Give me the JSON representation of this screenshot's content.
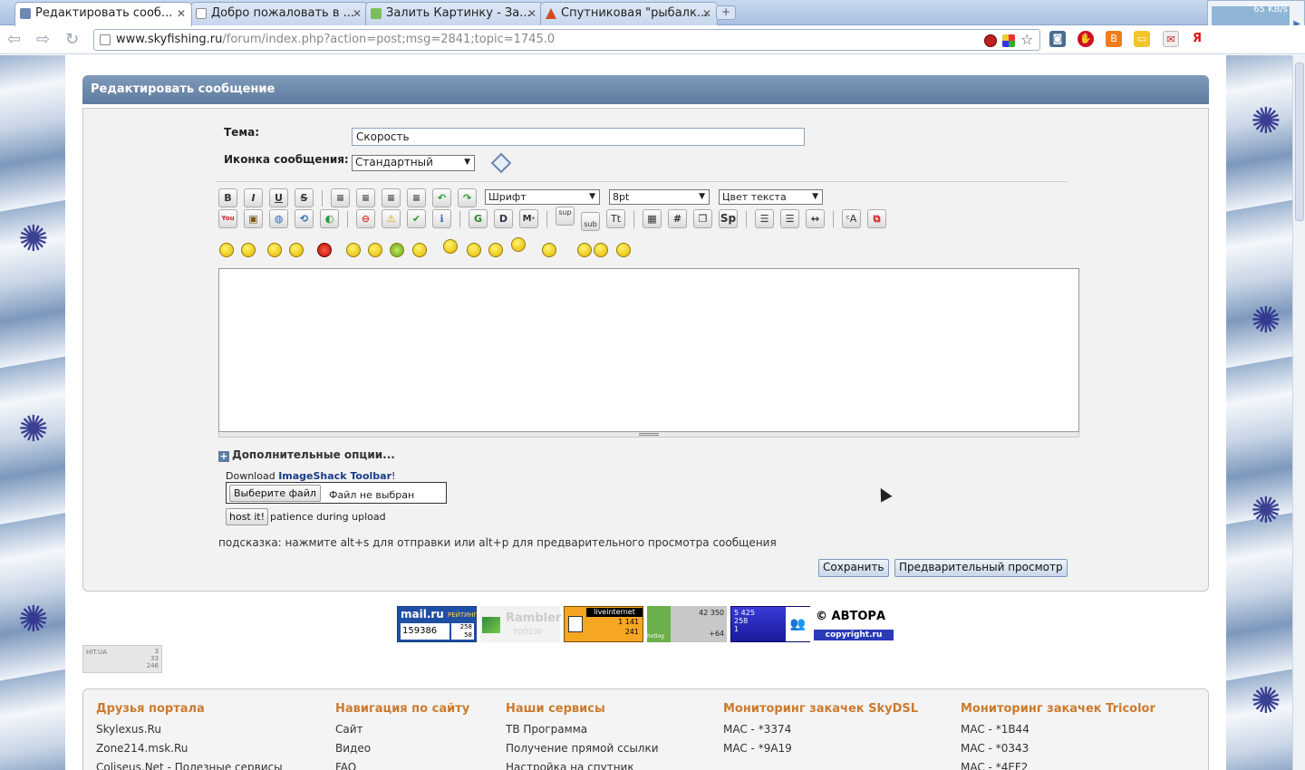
{
  "browser": {
    "tabs": [
      {
        "title": "Редактировать сооб...",
        "active": true
      },
      {
        "title": "Добро пожаловать в ...",
        "active": false
      },
      {
        "title": "Залить Картинку - За...",
        "active": false
      },
      {
        "title": "Спутниковая \"рыбалк...",
        "active": false
      }
    ],
    "close_glyph": "✕",
    "new_tab_glyph": "+",
    "url_site": "www.skyfishing.ru",
    "url_rest": "/forum/index.php?action=post;msg=2841;topic=1745.0",
    "net_rate": "65 KB/s"
  },
  "page": {
    "section_title": "Редактировать сообщение",
    "subject_label": "Тема:",
    "subject_value": "Скорость",
    "icon_label": "Иконка сообщения:",
    "icon_select": "Стандартный",
    "font_select": "Шрифт",
    "size_select": "8pt",
    "color_select": "Цвет текста",
    "format_buttons": [
      "B",
      "I",
      "U",
      "S"
    ],
    "more_options": "Дополнительные опции...",
    "imageshack_prefix": "Download ",
    "imageshack_link": "ImageShack Toolbar",
    "imageshack_suffix": "!",
    "file_button": "Выберите файл",
    "file_status": "Файл не выбран",
    "host_button": "host it!",
    "host_text": "patience during upload",
    "hint": "подсказка: нажмите alt+s для отправки или alt+p для предварительного просмотра сообщения",
    "save_button": "Сохранить",
    "preview_button": "Предварительный просмотр"
  },
  "counters": {
    "mailru": {
      "brand": "mail.ru",
      "tag": "РЕЙТИНГ",
      "total": "159386",
      "a": "258",
      "b": "58"
    },
    "rambler": {
      "brand": "Rambler",
      "sub": "ТОП100"
    },
    "liveinternet": {
      "brand": "liveinternet",
      "a": "1 141",
      "b": "241"
    },
    "hotlog": {
      "brand": "hotlog",
      "a": "42 350",
      "b": "+64"
    },
    "spylog": {
      "a": "5 425",
      "b": "258",
      "c": "1"
    },
    "avtora": {
      "brand": "© АВТОРА",
      "sub": "copyright.ru"
    },
    "hitua": {
      "brand": "HIT.UA",
      "a": "3",
      "b": "33",
      "c": "246"
    }
  },
  "footer": {
    "columns": [
      {
        "title": "Друзья портала",
        "items": [
          "Skylexus.Ru",
          "Zone214.msk.Ru",
          "Coliseus.Net - Полезные сервисы"
        ]
      },
      {
        "title": "Навигация по сайту",
        "items": [
          "Сайт",
          "Видео",
          "FAQ"
        ]
      },
      {
        "title": "Наши сервисы",
        "items": [
          "ТВ Программа",
          "Получение прямой ссылки",
          "Настройка на спутник"
        ]
      },
      {
        "title": "Мониторинг закачек SkyDSL",
        "items": [
          "MAC - *3374",
          "MAC - *9A19"
        ]
      },
      {
        "title": "Мониторинг закачек Tricolor",
        "items": [
          "MAC - *1B44",
          "MAC - *0343",
          "MAC - *4EF2"
        ]
      }
    ]
  },
  "colors": {
    "accent": "#cc7a2e",
    "header": "#6d88ab",
    "link": "#1a3c8a"
  }
}
